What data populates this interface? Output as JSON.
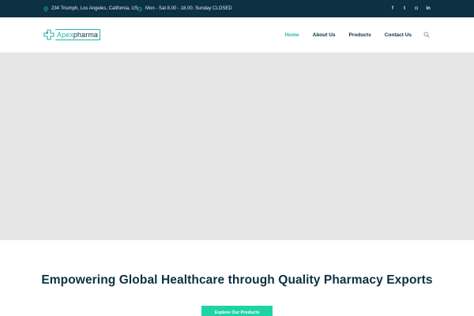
{
  "topbar": {
    "address": "234 Triumph, Los Angeles, California, US",
    "hours": "Mon - Sat 8.00 - 18.00. Sunday CLOSED",
    "address_icon": "map-pin-icon",
    "hours_icon": "clock-icon",
    "socials": [
      {
        "icon": "facebook-icon",
        "glyph": "f"
      },
      {
        "icon": "twitter-icon",
        "glyph": "t"
      },
      {
        "icon": "instagram-icon",
        "glyph": "◘"
      },
      {
        "icon": "linkedin-icon",
        "glyph": "in"
      }
    ]
  },
  "header": {
    "logo": {
      "part1": "Apex",
      "part2": "pharma"
    },
    "nav": [
      {
        "label": "Home",
        "active": true
      },
      {
        "label": "About Us",
        "active": false
      },
      {
        "label": "Products",
        "active": false
      },
      {
        "label": "Contact Us",
        "active": false
      }
    ],
    "search_icon": "search-icon"
  },
  "hero": {
    "headline": "Empowering Global Healthcare through Quality Pharmacy Exports",
    "cta_label": "Explore Our Products"
  },
  "colors": {
    "topbar_bg": "#0b3142",
    "accent": "#22b8a8",
    "cta_bg": "#1fd3a6",
    "heading": "#0b3142",
    "hero_placeholder": "#e6e6e6"
  }
}
